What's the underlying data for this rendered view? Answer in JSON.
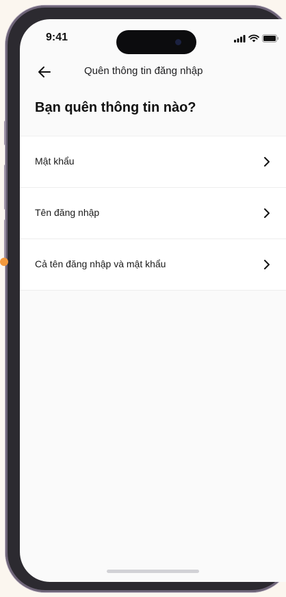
{
  "status_bar": {
    "time": "9:41",
    "icons": [
      "signal-icon",
      "wifi-icon",
      "battery-icon"
    ]
  },
  "nav": {
    "title": "Quên thông tin đăng nhập",
    "back_icon": "arrow-left-icon"
  },
  "heading": "Bạn quên thông tin nào?",
  "options": [
    {
      "label": "Mật khẩu"
    },
    {
      "label": "Tên đăng nhập"
    },
    {
      "label": "Cả tên đăng nhập và mật khẩu"
    }
  ],
  "colors": {
    "background": "#fbf6ef",
    "screen": "#fafafa",
    "frame": "#2c2a30",
    "accent_dot": "#f2993d"
  }
}
